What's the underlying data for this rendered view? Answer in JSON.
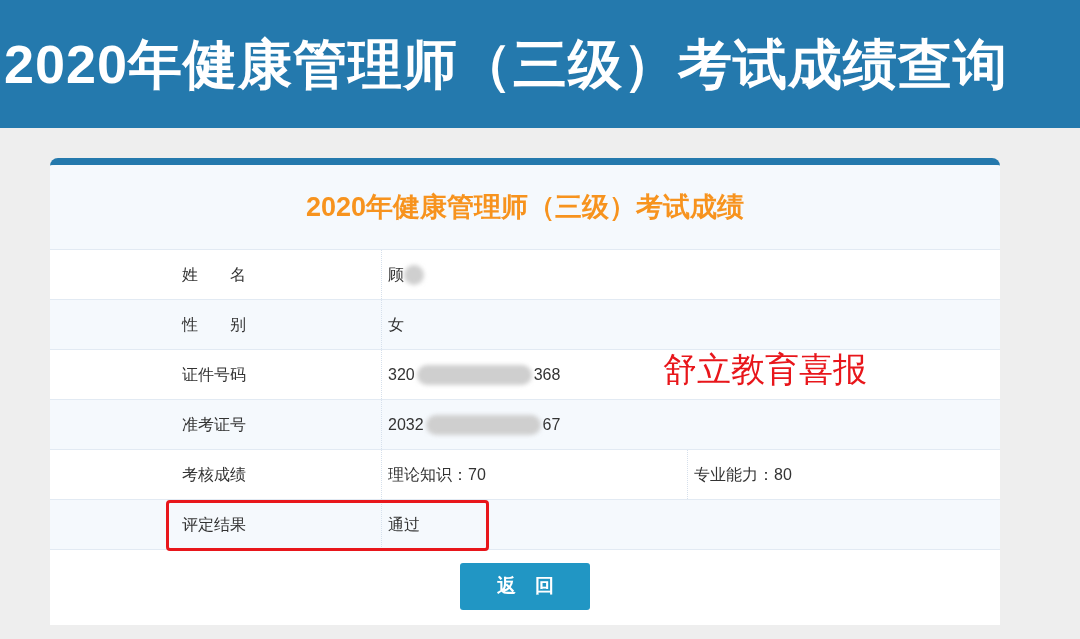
{
  "banner": {
    "title": "2020年健康管理师（三级）考试成绩查询"
  },
  "card": {
    "title": "2020年健康管理师（三级）考试成绩",
    "rows": [
      {
        "kind": "single",
        "label": "姓　　名",
        "value_start": "顾",
        "redacted": true
      },
      {
        "kind": "single",
        "label": "性　　别",
        "value_start": "女",
        "redacted": false
      },
      {
        "kind": "single",
        "label": "证件号码",
        "value_start": "320",
        "redacted": true,
        "value_end": "368"
      },
      {
        "kind": "single",
        "label": "准考证号",
        "value_start": "2032",
        "redacted": true,
        "value_end": "67"
      },
      {
        "kind": "split",
        "label": "考核成绩",
        "value_start": "理论知识：70",
        "value_second": "专业能力：80"
      },
      {
        "kind": "single",
        "label": "评定结果",
        "value_start": "通过",
        "redacted": false,
        "highlighted": true
      }
    ],
    "button": "返　回"
  },
  "annotation": "舒立教育喜报"
}
